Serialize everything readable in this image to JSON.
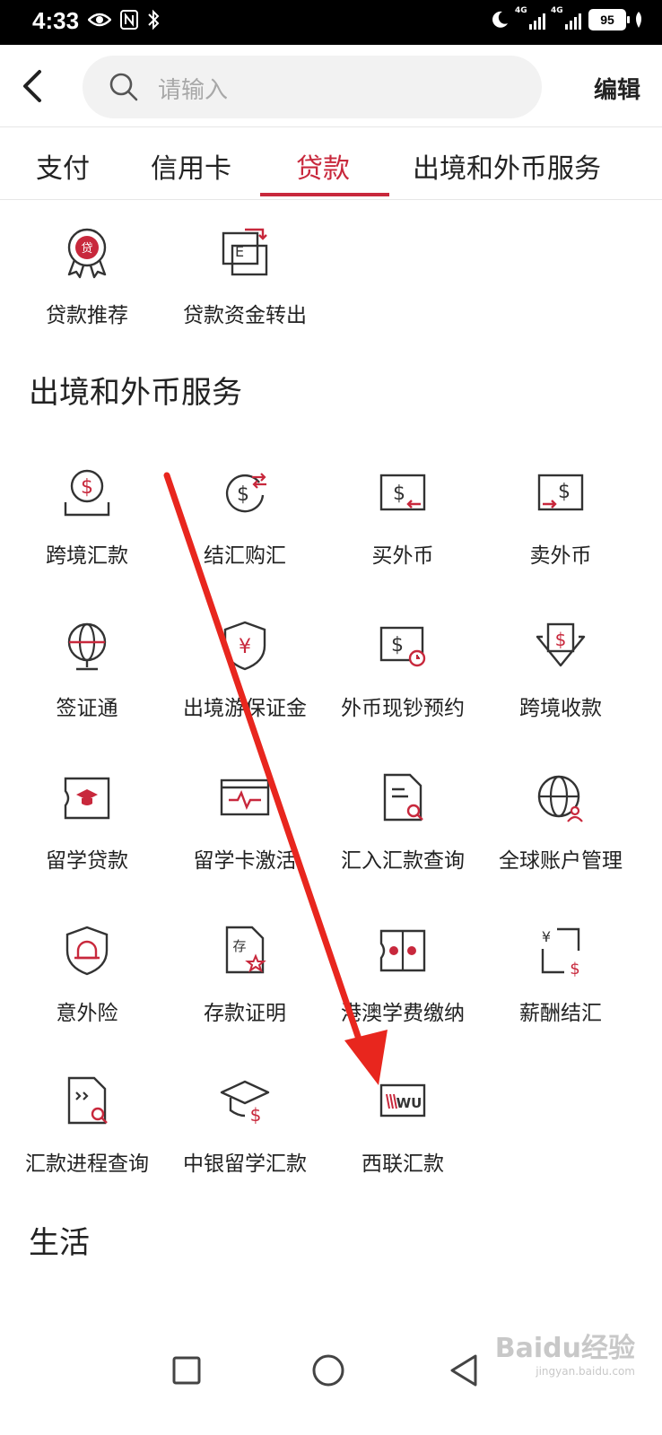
{
  "status_bar": {
    "time": "4:33",
    "battery": "95",
    "network_1": "4G",
    "network_2": "4G"
  },
  "header": {
    "search_placeholder": "请输入",
    "edit_label": "编辑"
  },
  "tabs": [
    {
      "label": "支付",
      "active": false
    },
    {
      "label": "信用卡",
      "active": false
    },
    {
      "label": "贷款",
      "active": true
    },
    {
      "label": "出境和外币服务",
      "active": false
    }
  ],
  "loan_items": [
    {
      "label": "贷款推荐",
      "icon": "loan-badge-icon"
    },
    {
      "label": "贷款资金转出",
      "icon": "fund-transfer-icon"
    }
  ],
  "section_overseas": {
    "title": "出境和外币服务",
    "items": [
      {
        "label": "跨境汇款",
        "icon": "cross-border-remit-icon"
      },
      {
        "label": "结汇购汇",
        "icon": "currency-exchange-icon"
      },
      {
        "label": "买外币",
        "icon": "buy-foreign-currency-icon"
      },
      {
        "label": "卖外币",
        "icon": "sell-foreign-currency-icon"
      },
      {
        "label": "签证通",
        "icon": "globe-visa-icon"
      },
      {
        "label": "出境游保证金",
        "icon": "yuan-shield-icon"
      },
      {
        "label": "外币现钞预约",
        "icon": "cash-appointment-icon"
      },
      {
        "label": "跨境收款",
        "icon": "dollar-download-icon"
      },
      {
        "label": "留学贷款",
        "icon": "study-loan-icon"
      },
      {
        "label": "留学卡激活",
        "icon": "card-activation-icon"
      },
      {
        "label": "汇入汇款查询",
        "icon": "document-search-icon"
      },
      {
        "label": "全球账户管理",
        "icon": "globe-user-icon"
      },
      {
        "label": "意外险",
        "icon": "alarm-shield-icon"
      },
      {
        "label": "存款证明",
        "icon": "deposit-certificate-icon"
      },
      {
        "label": "港澳学费缴纳",
        "icon": "hk-macau-tuition-icon"
      },
      {
        "label": "薪酬结汇",
        "icon": "salary-exchange-icon"
      },
      {
        "label": "汇款进程查询",
        "icon": "remit-progress-icon"
      },
      {
        "label": "中银留学汇款",
        "icon": "graduation-cap-dollar-icon"
      },
      {
        "label": "西联汇款",
        "icon": "western-union-icon"
      }
    ]
  },
  "section_life": {
    "title": "生活"
  },
  "watermark": {
    "brand": "Baidu经验",
    "site": "jingyan.baidu.com"
  },
  "colors": {
    "accent": "#c8283c",
    "arrow": "#e8261e"
  }
}
